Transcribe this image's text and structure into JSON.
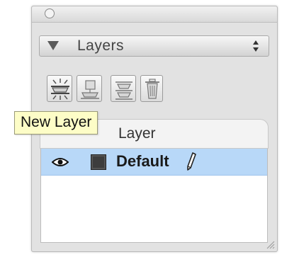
{
  "panel": {
    "header_title": "Layers"
  },
  "list": {
    "column_header": "Layer",
    "layers": [
      {
        "name": "Default",
        "visible": true,
        "selected": true,
        "color": "#3d3d3d"
      }
    ]
  },
  "tooltip": {
    "text": "New Layer"
  },
  "icons": {
    "close": "close-icon",
    "disclosure": "disclosure-triangle-icon",
    "updown": "updown-arrows-icon",
    "new_layer": "new-layer-icon",
    "new_sublayer": "new-sublayer-icon",
    "layer_options": "layer-options-icon",
    "delete": "trash-icon",
    "visibility": "eye-icon",
    "edit": "pencil-icon",
    "resize": "resize-grip-icon"
  },
  "colors": {
    "selection": "#b8d8f8",
    "tooltip_bg": "#fdfdc7",
    "panel_bg": "#e2e2e2"
  }
}
